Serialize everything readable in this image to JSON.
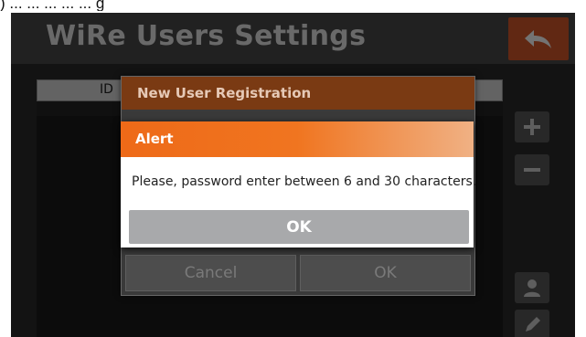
{
  "doc_caption": ") ... ... ... ... ...  g",
  "app": {
    "title": "WiRe Users Settings",
    "table_header_id": "ID"
  },
  "registration_dialog": {
    "title": "New User Registration",
    "cancel_label": "Cancel",
    "ok_label": "OK"
  },
  "alert": {
    "title": "Alert",
    "message": "Please, password enter between 6 and 30 characters.",
    "ok_label": "OK"
  },
  "colors": {
    "header_bg": "#4a4a4a",
    "back_button": "#d85a2a",
    "alert_title_orange": "#ee6a18",
    "registration_title_brown": "#7a3a13",
    "ok_button_gray": "#a8a9ab"
  },
  "icons": {
    "back": "back-arrow-icon",
    "add": "plus-icon",
    "remove": "minus-icon",
    "user": "user-icon",
    "edit": "pencil-icon"
  }
}
